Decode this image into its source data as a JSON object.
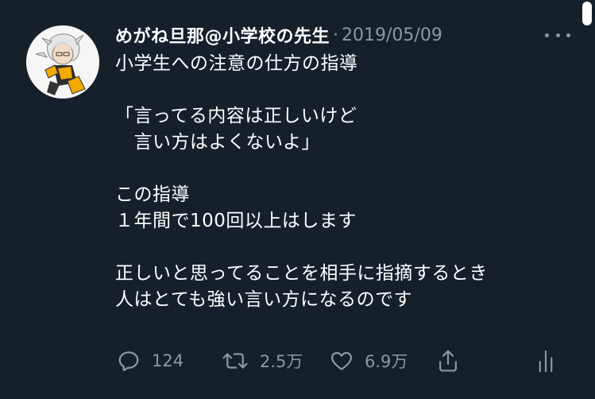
{
  "tweet": {
    "display_name": "めがね旦那@小学校の先生",
    "separator": "·",
    "date": "2019/05/09",
    "lines": [
      "小学生への注意の仕方の指導",
      "",
      "「言ってる内容は正しいけど",
      "　言い方はよくないよ」",
      "",
      "この指導",
      "１年間で100回以上はします",
      "",
      "正しいと思ってることを相手に指摘するとき",
      "人はとても強い言い方になるのです"
    ]
  },
  "actions": {
    "reply_count": "124",
    "retweet_count": "2.5万",
    "like_count": "6.9万",
    "icons": [
      "reply-icon",
      "retweet-icon",
      "like-icon",
      "share-icon",
      "analytics-icon"
    ]
  },
  "colors": {
    "background": "#15202b",
    "text": "#ffffff",
    "secondary": "#8b98a5"
  }
}
